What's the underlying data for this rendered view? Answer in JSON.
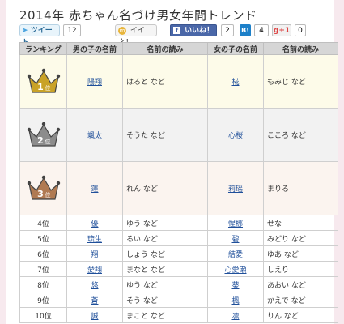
{
  "page": {
    "title": "2014年 赤ちゃん名づけ男女年間トレンド"
  },
  "social": {
    "tweet_label": "ツイート",
    "tweet_count": "12",
    "iine_label": "イイネ！",
    "facebook_label": "いいね！",
    "facebook_count": "2",
    "hatena_label": "B!",
    "hatena_count": "4",
    "gplus_label": "g+1",
    "gplus_count": "0"
  },
  "table": {
    "headers": {
      "rank": "ランキング",
      "boy_name": "男の子の名前",
      "boy_reading": "名前の読み",
      "girl_name": "女の子の名前",
      "girl_reading": "名前の読み"
    },
    "top": [
      {
        "rank_num": "1",
        "rank_suffix": "位",
        "crown_color": "#c9a227",
        "boy": "陽翔",
        "boy_reading": "はると など",
        "girl": "椛",
        "girl_reading": "もみじ など"
      },
      {
        "rank_num": "2",
        "rank_suffix": "位",
        "crown_color": "#8c8c8c",
        "boy": "颯太",
        "boy_reading": "そうた など",
        "girl": "心桜",
        "girl_reading": "こころ など"
      },
      {
        "rank_num": "3",
        "rank_suffix": "位",
        "crown_color": "#b07a52",
        "boy": "蓮",
        "boy_reading": "れん など",
        "girl": "莉瑶",
        "girl_reading": "まりる"
      }
    ],
    "rows": [
      {
        "rank": "4位",
        "boy": "優",
        "boy_reading": "ゆう など",
        "girl": "惺梛",
        "girl_reading": "せな"
      },
      {
        "rank": "5位",
        "boy": "琉生",
        "boy_reading": "るい など",
        "girl": "碧",
        "girl_reading": "みどり など"
      },
      {
        "rank": "6位",
        "boy": "翔",
        "boy_reading": "しょう など",
        "girl": "結愛",
        "girl_reading": "ゆあ など"
      },
      {
        "rank": "7位",
        "boy": "愛翔",
        "boy_reading": "まなと など",
        "girl": "心愛瀬",
        "girl_reading": "しえり"
      },
      {
        "rank": "8位",
        "boy": "悠",
        "boy_reading": "ゆう など",
        "girl": "葵",
        "girl_reading": "あおい など"
      },
      {
        "rank": "9位",
        "boy": "蒼",
        "boy_reading": "そう など",
        "girl": "楓",
        "girl_reading": "かえで など"
      },
      {
        "rank": "10位",
        "boy": "誠",
        "boy_reading": "まこと など",
        "girl": "凛",
        "girl_reading": "りん など"
      }
    ]
  }
}
